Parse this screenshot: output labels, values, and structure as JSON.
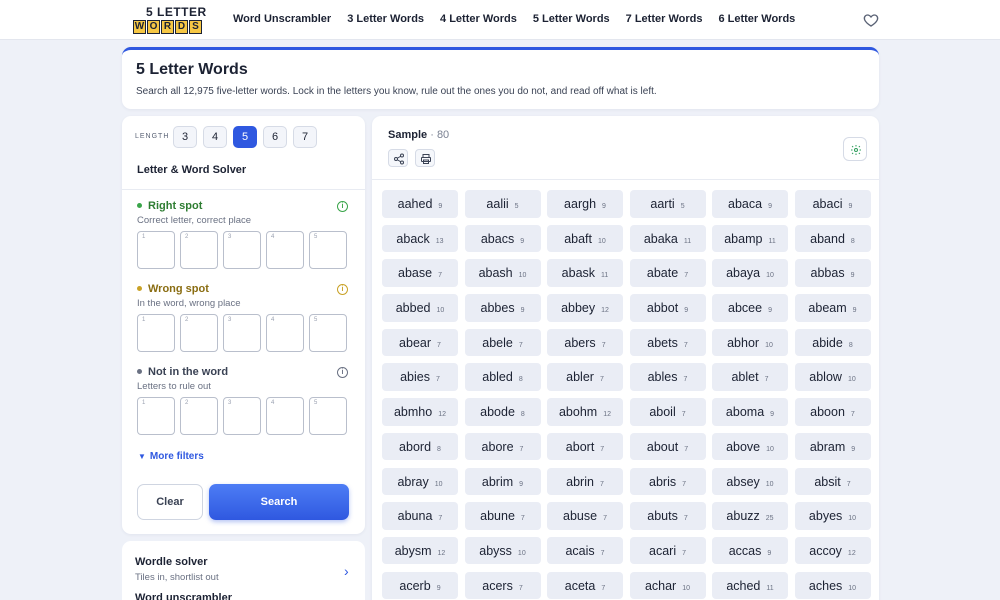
{
  "header": {
    "logo_top": "5 LETTER",
    "logo_tiles": [
      "W",
      "O",
      "R",
      "D",
      "S"
    ],
    "nav": [
      "Word Unscrambler",
      "3 Letter Words",
      "4 Letter Words",
      "5 Letter Words",
      "7 Letter Words",
      "6 Letter Words"
    ],
    "favorite_icon": "heart-icon"
  },
  "intro": {
    "title": "5 Letter Words",
    "text": "Search all 12,975 five-letter words. Lock in the letters you know, rule out the ones you do not, and read off what is left."
  },
  "solver": {
    "length_label": "LENGTH",
    "lengths": [
      "3",
      "4",
      "5",
      "6",
      "7"
    ],
    "selected_length": "5",
    "title": "Letter & Word Solver",
    "groups": [
      {
        "key": "right",
        "title": "Right spot",
        "subtitle": "Correct letter, correct place",
        "color": "#3aa54a",
        "text_color": "#2e7d32"
      },
      {
        "key": "wrong",
        "title": "Wrong spot",
        "subtitle": "In the word, wrong place",
        "color": "#c9a227",
        "text_color": "#8a6d12"
      },
      {
        "key": "absent",
        "title": "Not in the word",
        "subtitle": "Letters to rule out",
        "color": "#6a7183",
        "text_color": "#3a4254"
      }
    ],
    "slot_numbers": [
      "1",
      "2",
      "3",
      "4",
      "5"
    ],
    "more_filters": "More filters",
    "clear_label": "Clear",
    "search_label": "Search"
  },
  "sidebar_links": {
    "wordle_title": "Wordle solver",
    "wordle_sub": "Tiles in, shortlist out",
    "unscrambler_title": "Word unscrambler"
  },
  "results": {
    "label": "Sample",
    "count": "80",
    "words": [
      {
        "w": "aahed",
        "s": "9"
      },
      {
        "w": "aalii",
        "s": "5"
      },
      {
        "w": "aargh",
        "s": "9"
      },
      {
        "w": "aarti",
        "s": "5"
      },
      {
        "w": "abaca",
        "s": "9"
      },
      {
        "w": "abaci",
        "s": "9"
      },
      {
        "w": "aback",
        "s": "13"
      },
      {
        "w": "abacs",
        "s": "9"
      },
      {
        "w": "abaft",
        "s": "10"
      },
      {
        "w": "abaka",
        "s": "11"
      },
      {
        "w": "abamp",
        "s": "11"
      },
      {
        "w": "aband",
        "s": "8"
      },
      {
        "w": "abase",
        "s": "7"
      },
      {
        "w": "abash",
        "s": "10"
      },
      {
        "w": "abask",
        "s": "11"
      },
      {
        "w": "abate",
        "s": "7"
      },
      {
        "w": "abaya",
        "s": "10"
      },
      {
        "w": "abbas",
        "s": "9"
      },
      {
        "w": "abbed",
        "s": "10"
      },
      {
        "w": "abbes",
        "s": "9"
      },
      {
        "w": "abbey",
        "s": "12"
      },
      {
        "w": "abbot",
        "s": "9"
      },
      {
        "w": "abcee",
        "s": "9"
      },
      {
        "w": "abeam",
        "s": "9"
      },
      {
        "w": "abear",
        "s": "7"
      },
      {
        "w": "abele",
        "s": "7"
      },
      {
        "w": "abers",
        "s": "7"
      },
      {
        "w": "abets",
        "s": "7"
      },
      {
        "w": "abhor",
        "s": "10"
      },
      {
        "w": "abide",
        "s": "8"
      },
      {
        "w": "abies",
        "s": "7"
      },
      {
        "w": "abled",
        "s": "8"
      },
      {
        "w": "abler",
        "s": "7"
      },
      {
        "w": "ables",
        "s": "7"
      },
      {
        "w": "ablet",
        "s": "7"
      },
      {
        "w": "ablow",
        "s": "10"
      },
      {
        "w": "abmho",
        "s": "12"
      },
      {
        "w": "abode",
        "s": "8"
      },
      {
        "w": "abohm",
        "s": "12"
      },
      {
        "w": "aboil",
        "s": "7"
      },
      {
        "w": "aboma",
        "s": "9"
      },
      {
        "w": "aboon",
        "s": "7"
      },
      {
        "w": "abord",
        "s": "8"
      },
      {
        "w": "abore",
        "s": "7"
      },
      {
        "w": "abort",
        "s": "7"
      },
      {
        "w": "about",
        "s": "7"
      },
      {
        "w": "above",
        "s": "10"
      },
      {
        "w": "abram",
        "s": "9"
      },
      {
        "w": "abray",
        "s": "10"
      },
      {
        "w": "abrim",
        "s": "9"
      },
      {
        "w": "abrin",
        "s": "7"
      },
      {
        "w": "abris",
        "s": "7"
      },
      {
        "w": "absey",
        "s": "10"
      },
      {
        "w": "absit",
        "s": "7"
      },
      {
        "w": "abuna",
        "s": "7"
      },
      {
        "w": "abune",
        "s": "7"
      },
      {
        "w": "abuse",
        "s": "7"
      },
      {
        "w": "abuts",
        "s": "7"
      },
      {
        "w": "abuzz",
        "s": "25"
      },
      {
        "w": "abyes",
        "s": "10"
      },
      {
        "w": "abysm",
        "s": "12"
      },
      {
        "w": "abyss",
        "s": "10"
      },
      {
        "w": "acais",
        "s": "7"
      },
      {
        "w": "acari",
        "s": "7"
      },
      {
        "w": "accas",
        "s": "9"
      },
      {
        "w": "accoy",
        "s": "12"
      },
      {
        "w": "acerb",
        "s": "9"
      },
      {
        "w": "acers",
        "s": "7"
      },
      {
        "w": "aceta",
        "s": "7"
      },
      {
        "w": "achar",
        "s": "10"
      },
      {
        "w": "ached",
        "s": "11"
      },
      {
        "w": "aches",
        "s": "10"
      }
    ]
  },
  "colors": {
    "accent": "#2f58e0",
    "tile_bg": "#eaedf5",
    "logo_yellow": "#f6c744"
  }
}
